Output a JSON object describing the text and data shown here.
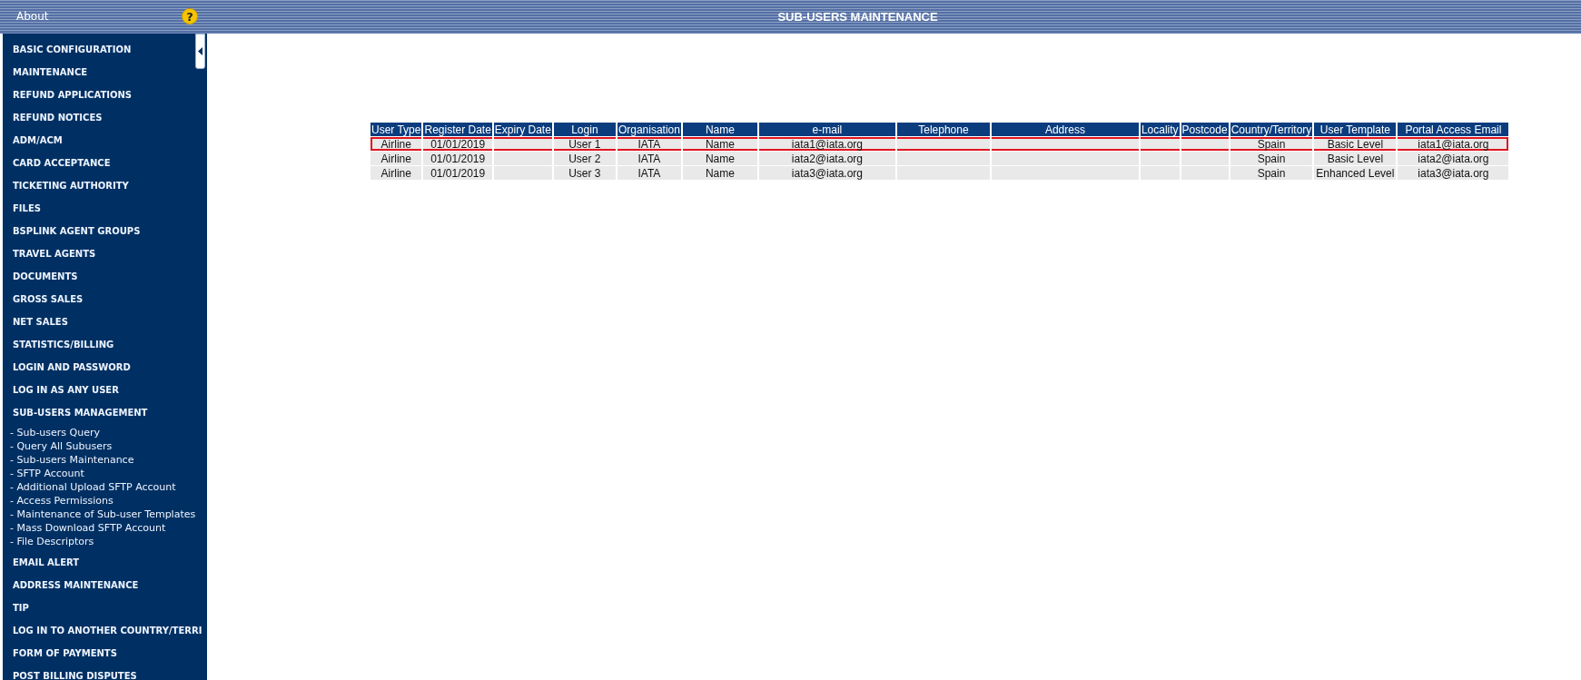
{
  "header": {
    "about": "About",
    "help": "?",
    "title": "SUB-USERS MAINTENANCE"
  },
  "sidebar": {
    "items": [
      {
        "label": "BASIC CONFIGURATION",
        "kind": "section"
      },
      {
        "label": "MAINTENANCE",
        "kind": "section"
      },
      {
        "label": "REFUND APPLICATIONS",
        "kind": "section"
      },
      {
        "label": "REFUND NOTICES",
        "kind": "section"
      },
      {
        "label": "ADM/ACM",
        "kind": "section"
      },
      {
        "label": "CARD ACCEPTANCE",
        "kind": "section"
      },
      {
        "label": "TICKETING AUTHORITY",
        "kind": "section"
      },
      {
        "label": "FILES",
        "kind": "section"
      },
      {
        "label": "BSPLINK AGENT GROUPS",
        "kind": "section"
      },
      {
        "label": "TRAVEL AGENTS",
        "kind": "section"
      },
      {
        "label": "DOCUMENTS",
        "kind": "section"
      },
      {
        "label": "GROSS SALES",
        "kind": "section"
      },
      {
        "label": "NET SALES",
        "kind": "section"
      },
      {
        "label": "STATISTICS/BILLING",
        "kind": "section"
      },
      {
        "label": "LOGIN AND PASSWORD",
        "kind": "section"
      },
      {
        "label": "LOG IN AS ANY USER",
        "kind": "section"
      },
      {
        "label": "SUB-USERS MANAGEMENT",
        "kind": "section"
      },
      {
        "label": "- Sub-users Query",
        "kind": "link"
      },
      {
        "label": "- Query All Subusers",
        "kind": "link"
      },
      {
        "label": "- Sub-users Maintenance",
        "kind": "link"
      },
      {
        "label": "- SFTP Account",
        "kind": "link"
      },
      {
        "label": "- Additional Upload SFTP Account",
        "kind": "link"
      },
      {
        "label": "- Access Permissions",
        "kind": "link"
      },
      {
        "label": "- Maintenance of Sub-user Templates",
        "kind": "link"
      },
      {
        "label": "- Mass Download SFTP Account",
        "kind": "link"
      },
      {
        "label": "- File Descriptors",
        "kind": "link"
      },
      {
        "label": "EMAIL ALERT",
        "kind": "section"
      },
      {
        "label": "ADDRESS MAINTENANCE",
        "kind": "section"
      },
      {
        "label": "TIP",
        "kind": "section"
      },
      {
        "label": "LOG IN TO ANOTHER COUNTRY/TERRI",
        "kind": "section"
      },
      {
        "label": "FORM OF PAYMENTS",
        "kind": "section"
      },
      {
        "label": "POST BILLING DISPUTES",
        "kind": "section"
      }
    ]
  },
  "table": {
    "columns": [
      "User Type",
      "Register Date",
      "Expiry Date",
      "Login",
      "Organisation",
      "Name",
      "e-mail",
      "Telephone",
      "Address",
      "Locality",
      "Postcode",
      "Country/Territory",
      "User Template",
      "Portal Access Email"
    ],
    "rows": [
      {
        "selected": true,
        "cells": [
          "Airline",
          "01/01/2019",
          "",
          "User 1",
          "IATA",
          "Name",
          "iata1@iata.org",
          "",
          "",
          "",
          "",
          "Spain",
          "Basic Level",
          "iata1@iata.org"
        ]
      },
      {
        "selected": false,
        "cells": [
          "Airline",
          "01/01/2019",
          "",
          "User 2",
          "IATA",
          "Name",
          "iata2@iata.org",
          "",
          "",
          "",
          "",
          "Spain",
          "Basic Level",
          "iata2@iata.org"
        ]
      },
      {
        "selected": false,
        "cells": [
          "Airline",
          "01/01/2019",
          "",
          "User 3",
          "IATA",
          "Name",
          "iata3@iata.org",
          "",
          "",
          "",
          "",
          "Spain",
          "Enhanced Level",
          "iata3@iata.org"
        ]
      }
    ]
  }
}
